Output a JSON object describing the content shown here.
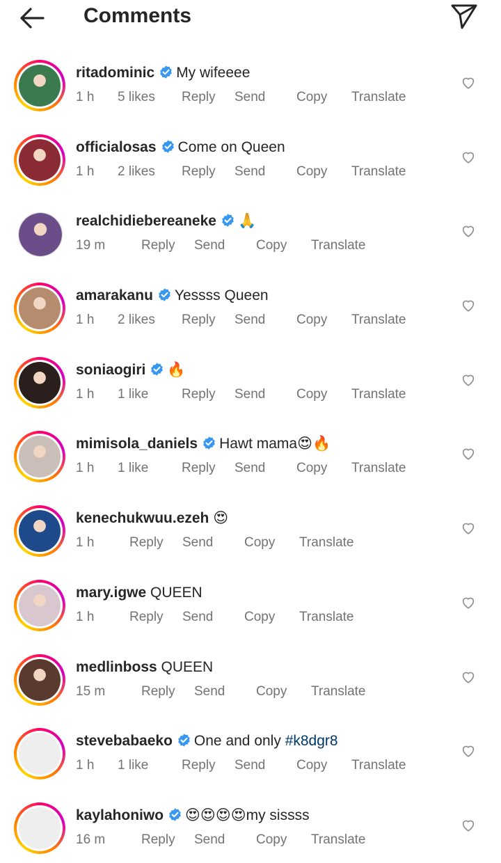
{
  "header": {
    "title": "Comments",
    "back_icon": "arrow-left-icon",
    "send_icon": "paper-plane-icon"
  },
  "colors": {
    "verified": "#3897f0",
    "meta": "#737373",
    "text": "#262626",
    "hashtag": "#00376b"
  },
  "comments": [
    {
      "user": "ritadominic",
      "verified": true,
      "text": "My wifeeee",
      "time": "1 h",
      "likes": "5 likes",
      "reply": "Reply",
      "send": "Send",
      "copy": "Copy",
      "translate": "Translate",
      "ring": true,
      "avatar_color": "#3b7a4f"
    },
    {
      "user": "officialosas",
      "verified": true,
      "text": "Come on Queen",
      "time": "1 h",
      "likes": "2 likes",
      "reply": "Reply",
      "send": "Send",
      "copy": "Copy",
      "translate": "Translate",
      "ring": true,
      "avatar_color": "#8b2b35"
    },
    {
      "user": "realchidiebereaneke",
      "verified": true,
      "text": "🙏",
      "time": "19 m",
      "likes": "",
      "reply": "Reply",
      "send": "Send",
      "copy": "Copy",
      "translate": "Translate",
      "ring": false,
      "avatar_color": "#6b4d8a"
    },
    {
      "user": "amarakanu",
      "verified": true,
      "text": "Yessss Queen",
      "time": "1 h",
      "likes": "2 likes",
      "reply": "Reply",
      "send": "Send",
      "copy": "Copy",
      "translate": "Translate",
      "ring": true,
      "avatar_color": "#b58c6e"
    },
    {
      "user": "soniaogiri",
      "verified": true,
      "text": "🔥",
      "time": "1 h",
      "likes": "1 like",
      "reply": "Reply",
      "send": "Send",
      "copy": "Copy",
      "translate": "Translate",
      "ring": true,
      "avatar_color": "#2b1f1d"
    },
    {
      "user": "mimisola_daniels",
      "verified": true,
      "text": "Hawt mama😍🔥",
      "time": "1 h",
      "likes": "1 like",
      "reply": "Reply",
      "send": "Send",
      "copy": "Copy",
      "translate": "Translate",
      "ring": true,
      "avatar_color": "#c9bfb8"
    },
    {
      "user": "kenechukwuu.ezeh",
      "verified": false,
      "text": "😍",
      "time": "1 h",
      "likes": "",
      "reply": "Reply",
      "send": "Send",
      "copy": "Copy",
      "translate": "Translate",
      "ring": true,
      "avatar_color": "#1e4a8c"
    },
    {
      "user": "mary.igwe",
      "verified": false,
      "text": "QUEEN",
      "time": "1 h",
      "likes": "",
      "reply": "Reply",
      "send": "Send",
      "copy": "Copy",
      "translate": "Translate",
      "ring": true,
      "avatar_color": "#d9c7cf"
    },
    {
      "user": "medlinboss",
      "verified": false,
      "text": "QUEEN",
      "time": "15 m",
      "likes": "",
      "reply": "Reply",
      "send": "Send",
      "copy": "Copy",
      "translate": "Translate",
      "ring": true,
      "avatar_color": "#5a3a2e"
    },
    {
      "user": "stevebabaeko",
      "verified": true,
      "text": "One and only ",
      "hashtag": "#k8dgr8",
      "time": "1 h",
      "likes": "1 like",
      "reply": "Reply",
      "send": "Send",
      "copy": "Copy",
      "translate": "Translate",
      "ring": true,
      "avatar_color": "#eeeeee"
    },
    {
      "user": "kaylahoniwo",
      "verified": true,
      "text": "😍😍😍😍my sissss",
      "time": "16 m",
      "likes": "",
      "reply": "Reply",
      "send": "Send",
      "copy": "Copy",
      "translate": "Translate",
      "ring": true,
      "avatar_color": "#eeeeee"
    }
  ]
}
